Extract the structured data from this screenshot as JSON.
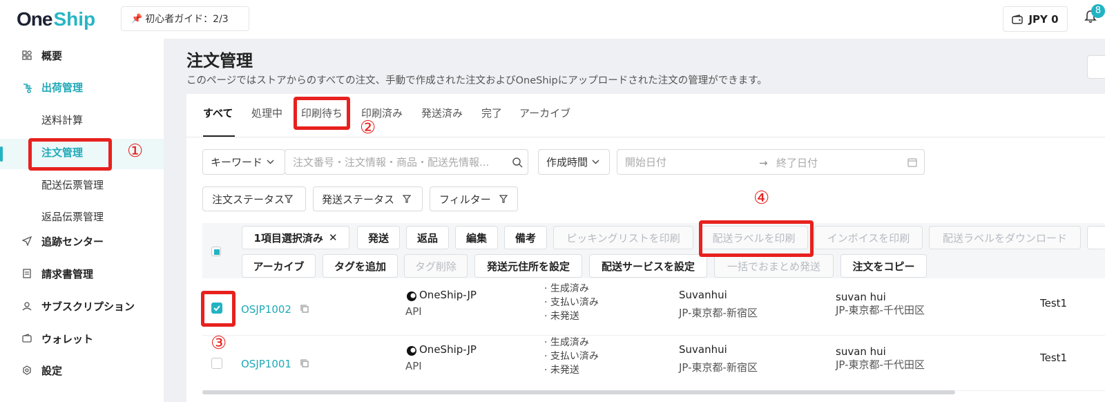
{
  "header": {
    "logo_one": "One",
    "logo_ship": "Ship",
    "guide_label": "初心者ガイド：2/3",
    "wallet_label": "JPY 0",
    "notification_count": "8"
  },
  "sidebar": {
    "items": [
      {
        "label": "概要",
        "icon": "dashboard-icon"
      },
      {
        "label": "出荷管理",
        "icon": "shipping-icon"
      },
      {
        "label": "送料計算"
      },
      {
        "label": "注文管理"
      },
      {
        "label": "配送伝票管理"
      },
      {
        "label": "返品伝票管理"
      },
      {
        "label": "追跡センター",
        "icon": "send-icon"
      },
      {
        "label": "請求書管理",
        "icon": "invoice-icon"
      },
      {
        "label": "サブスクリプション",
        "icon": "user-icon"
      },
      {
        "label": "ウォレット",
        "icon": "wallet-icon"
      },
      {
        "label": "設定",
        "icon": "settings-icon"
      }
    ]
  },
  "main": {
    "title": "注文管理",
    "description": "このページではストアからのすべての注文、手動で作成された注文およびOneShipにアップロードされた注文の管理ができます。",
    "tabs": [
      "すべて",
      "処理中",
      "印刷待ち",
      "印刷済み",
      "発送済み",
      "完了",
      "アーカイブ"
    ],
    "filters": {
      "keyword_select": "キーワード",
      "search_placeholder": "注文番号・注文情報・商品・配送先情報...",
      "time_select": "作成時間",
      "start_date_placeholder": "開始日付",
      "end_date_placeholder": "終了日付",
      "order_status": "注文ステータス",
      "shipping_status": "発送ステータス",
      "filter": "フィルター"
    },
    "bulk_actions": {
      "selected": "1項目選択済み",
      "row1": [
        "発送",
        "返品",
        "編集",
        "備考",
        "ピッキングリストを印刷",
        "配送ラベルを印刷",
        "インボイスを印刷",
        "配送ラベルをダウンロード"
      ],
      "row2": [
        "アーカイブ",
        "タグを追加",
        "タグ削除",
        "発送元住所を設定",
        "配送サービスを設定",
        "一括でおまとめ発送",
        "注文をコピー"
      ]
    },
    "orders": [
      {
        "id": "OSJP1002",
        "channel": "OneShip-JP",
        "source": "API",
        "statuses": [
          "· 生成済み",
          "· 支払い済み",
          "· 未発送"
        ],
        "sender_name": "Suvanhui",
        "sender_address": "JP-東京都-新宿区",
        "recipient_name": "suvan hui",
        "recipient_address": "JP-東京都-千代田区",
        "note": "Test1",
        "checked": true
      },
      {
        "id": "OSJP1001",
        "channel": "OneShip-JP",
        "source": "API",
        "statuses": [
          "· 生成済み",
          "· 支払い済み",
          "· 未発送"
        ],
        "sender_name": "Suvanhui",
        "sender_address": "JP-東京都-新宿区",
        "recipient_name": "suvan hui",
        "recipient_address": "JP-東京都-千代田区",
        "note": "Test1",
        "checked": false
      }
    ]
  },
  "annotations": [
    "①",
    "②",
    "③",
    "④"
  ],
  "colors": {
    "accent": "#22b3c3",
    "annotation": "#e7211e"
  }
}
